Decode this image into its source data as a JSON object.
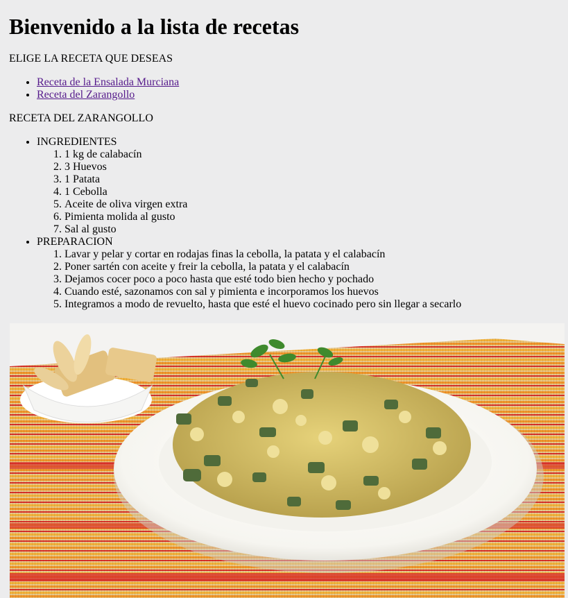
{
  "page": {
    "heading": "Bienvenido a la lista de recetas",
    "choose_label": "ELIGE LA RECETA QUE DESEAS"
  },
  "links": [
    "Receta de la Ensalada Murciana",
    "Receta del Zarangollo"
  ],
  "recipe": {
    "title": "RECETA DEL ZARANGOLLO",
    "ingredients_label": "INGREDIENTES",
    "ingredients": [
      "1 kg de calabacín",
      "3 Huevos",
      "1 Patata",
      "1 Cebolla",
      "Aceite de oliva virgen extra",
      "Pimienta molida al gusto",
      "Sal al gusto"
    ],
    "preparation_label": "PREPARACION",
    "steps": [
      "Lavar y pelar y cortar en rodajas finas la cebolla, la patata y el calabacín",
      "Poner sartén con aceite y freir la cebolla, la patata y el calabacín",
      "Dejamos cocer poco a poco hasta que esté todo bien hecho y pochado",
      "Cuando esté, sazonamos con sal y pimienta e incorporamos los huevos",
      "Integramos a modo de revuelto, hasta que esté el huevo cocinado pero sin llegar a secarlo"
    ]
  },
  "colors": {
    "background": "#ececed",
    "link": "#551a8b",
    "placemat_orange": "#f0952a",
    "placemat_red": "#d8312a",
    "plate": "#fbfbf8",
    "zucchini_green": "#4f6b3a",
    "egg_yellow": "#d9c46a"
  }
}
